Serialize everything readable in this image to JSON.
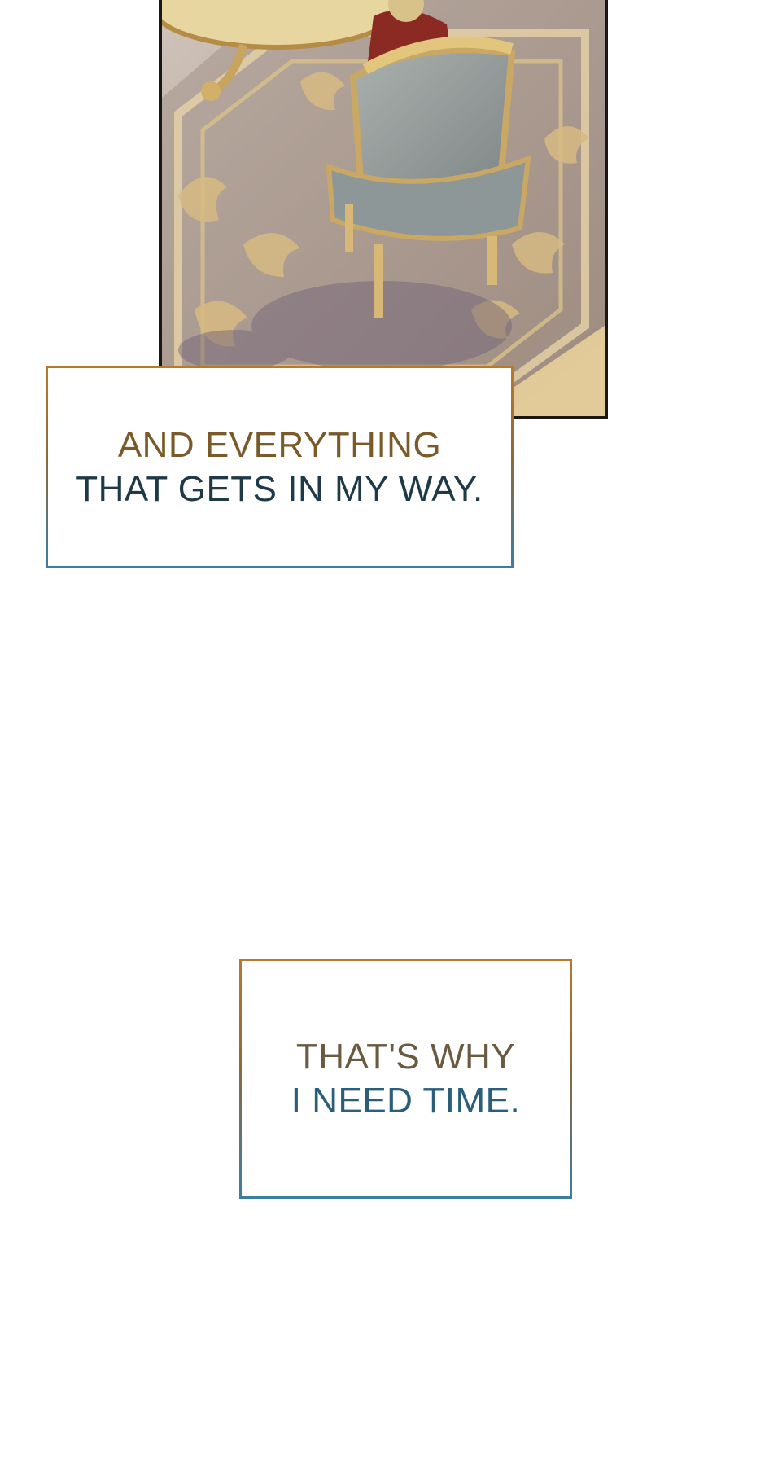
{
  "panel": {
    "scene": "illustration"
  },
  "captions": [
    {
      "line1": "AND EVERYTHING",
      "line2": "THAT GETS IN MY WAY."
    },
    {
      "line1": "THAT'S WHY",
      "line2": "I NEED TIME."
    }
  ],
  "colors": {
    "border_top": "#b87a2a",
    "border_bottom": "#3a7ea6",
    "text_gold": "#7a5a28",
    "text_dark": "#1e3a48"
  }
}
